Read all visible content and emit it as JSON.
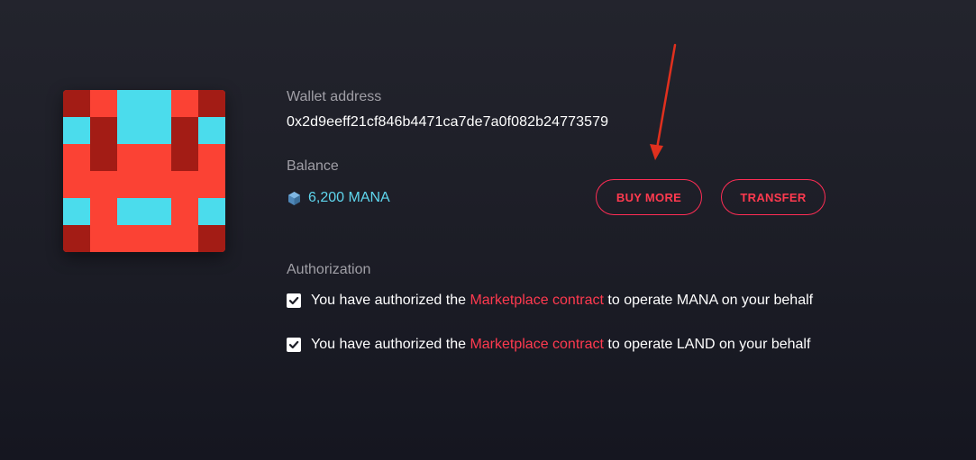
{
  "profile": {
    "avatar_icon": "pixel-avatar",
    "avatar_colors": {
      "dark": "#a31c15",
      "red": "#fb4234",
      "cyan": "#4bdcec"
    }
  },
  "wallet": {
    "label": "Wallet address",
    "address": "0x2d9eeff21cf846b4471ca7de7a0f082b24773579"
  },
  "balance": {
    "label": "Balance",
    "icon": "mana-icon",
    "amount": "6,200 MANA"
  },
  "actions": {
    "buy_more": "BUY MORE",
    "transfer": "TRANSFER"
  },
  "authorization": {
    "label": "Authorization",
    "items": [
      {
        "checked": true,
        "prefix": "You have authorized the ",
        "link": "Marketplace contract",
        "suffix": " to operate MANA on your behalf"
      },
      {
        "checked": true,
        "prefix": "You have authorized the ",
        "link": "Marketplace contract",
        "suffix": " to operate LAND on your behalf"
      }
    ]
  },
  "colors": {
    "accent": "#ff3a4f",
    "mana": "#5fd6ee",
    "annotation_arrow": "#e0301e"
  }
}
